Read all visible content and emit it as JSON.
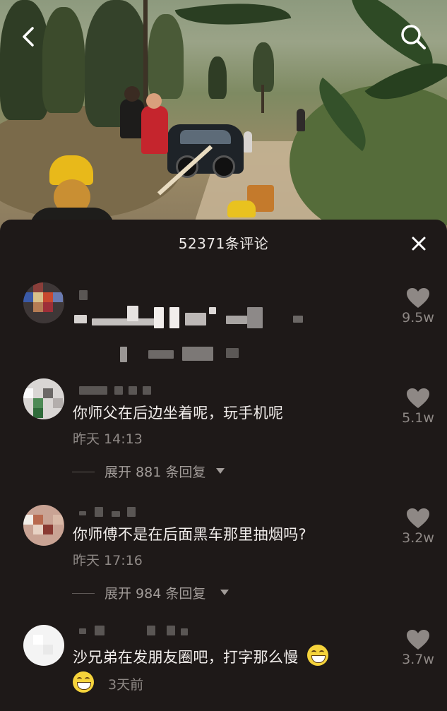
{
  "sheet": {
    "title": "52371条评论"
  },
  "icons": {
    "back": "chevron-left-icon",
    "search": "search-icon",
    "close": "close-icon",
    "like": "heart-icon",
    "emoji": "grin-emoji-icon"
  },
  "comments": [
    {
      "text": "",
      "time": "",
      "like_count": "9.5w",
      "reply_label": ""
    },
    {
      "text": "你师父在后边坐着呢，玩手机呢",
      "time": "昨天 14:13",
      "like_count": "5.1w",
      "reply_label": "展开 881 条回复"
    },
    {
      "text": "你师傅不是在后面黑车那里抽烟吗?",
      "time": "昨天 17:16",
      "like_count": "3.2w",
      "reply_label": "展开 984 条回复"
    },
    {
      "text": "沙兄弟在发朋友圈吧，打字那么慢",
      "time": "3天前",
      "like_count": "3.7w",
      "reply_label": ""
    }
  ],
  "colors": {
    "sheet_bg": "#1e1918",
    "text_primary": "#f2eeec",
    "text_secondary": "#8e8885",
    "like_icon": "#8e8885"
  }
}
